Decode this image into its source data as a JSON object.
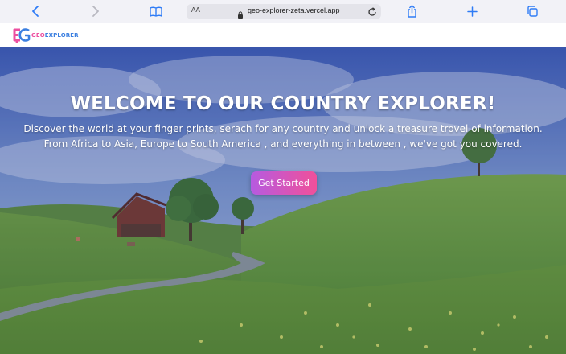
{
  "browser": {
    "url": "geo-explorer-zeta.vercel.app",
    "reader_label": "AA",
    "accent": "#2f7cf6"
  },
  "site": {
    "logo_text_primary": "GEO",
    "logo_text_secondary": "EXPLORER",
    "logo_mark": "GE",
    "brand_pink": "#ec4fa0",
    "brand_blue": "#3b7fe0"
  },
  "hero": {
    "title": "WELCOME TO OUR COUNTRY EXPLORER!",
    "subtitle_line1": "Discover the world at your finger prints, serach for any country and unlock a treasure trovel of information.",
    "subtitle_line2": "From Africa to Asia, Europe to South America , and everything in between , we've got you covered.",
    "cta_label": "Get Started",
    "cta_gradient": [
      "#b65be0",
      "#f0509a"
    ]
  }
}
